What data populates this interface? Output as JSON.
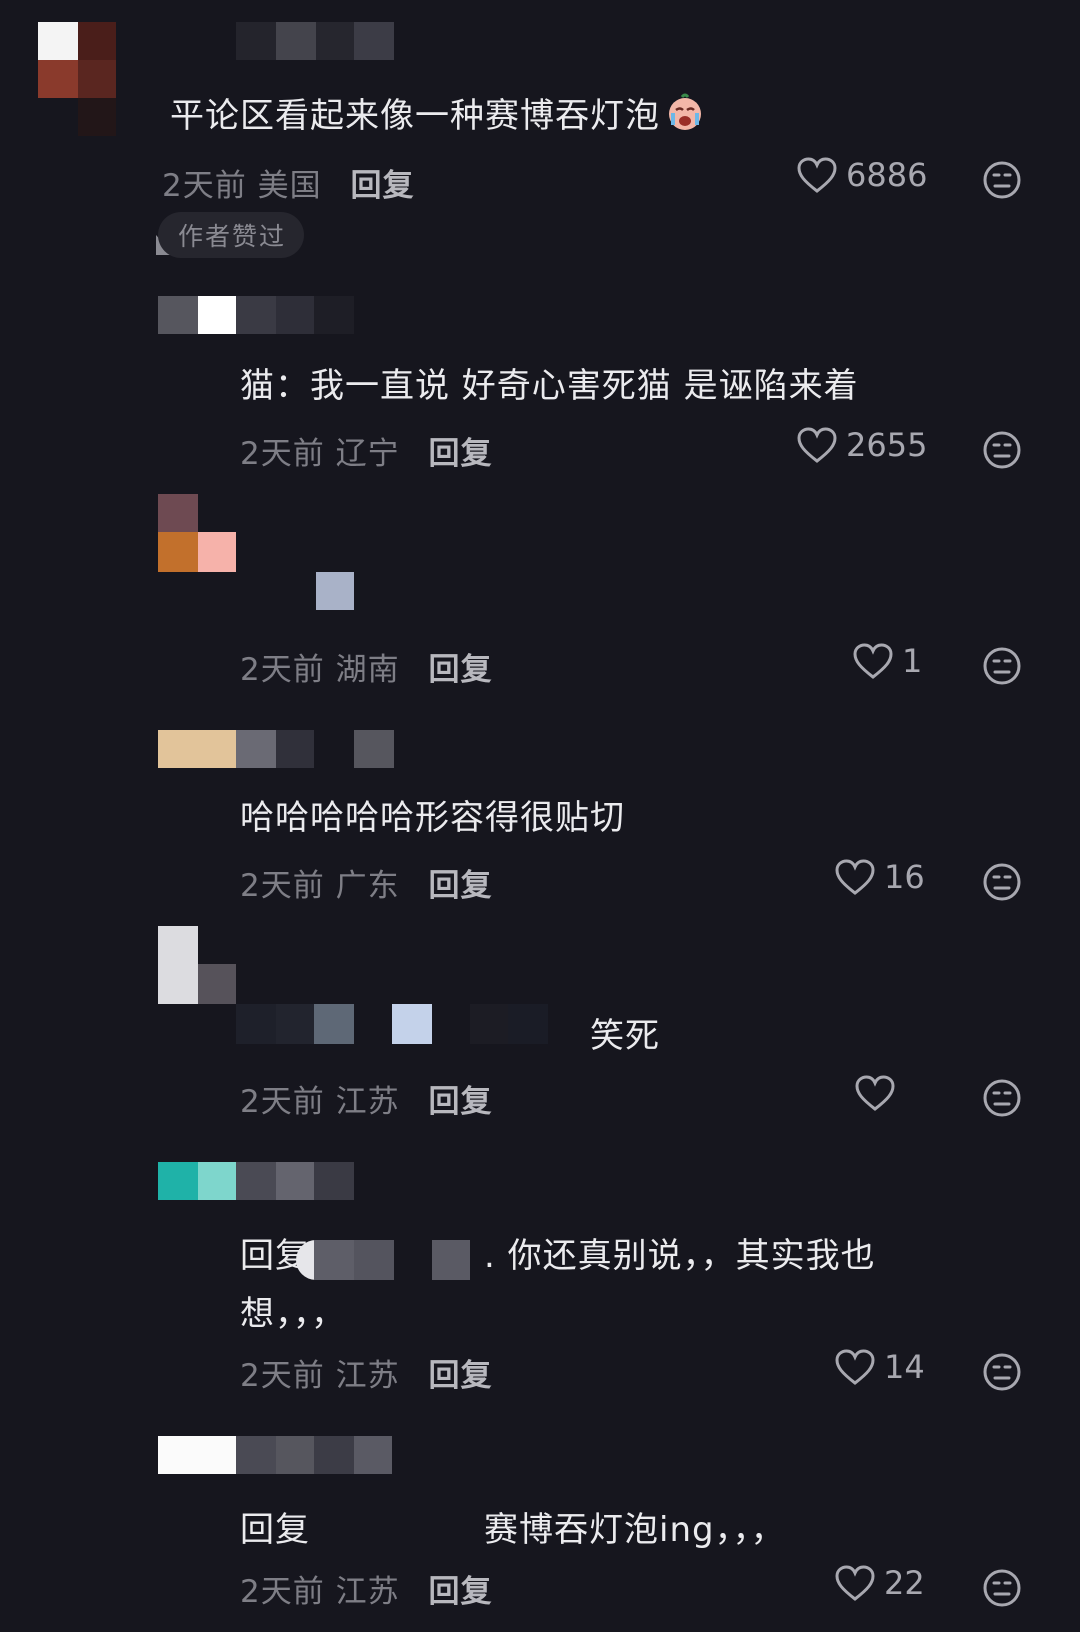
{
  "colors": {
    "background": "#16161e",
    "text": "#ebebee",
    "meta": "#7e7e86",
    "reply": "#b8b8be"
  },
  "comments": [
    {
      "text": "平论区看起来像一种赛博吞灯泡",
      "emoji": "crying-face-emoji",
      "time": "2天前",
      "location": "美国",
      "reply_label": "回复",
      "likes": "6886",
      "badge": "作者赞过"
    },
    {
      "text": "猫：我一直说 好奇心害死猫 是诬陷来着",
      "time": "2天前",
      "location": "辽宁",
      "reply_label": "回复",
      "likes": "2655"
    },
    {
      "text": "",
      "time": "2天前",
      "location": "湖南",
      "reply_label": "回复",
      "likes": "1"
    },
    {
      "text": "哈哈哈哈哈形容得很贴切",
      "time": "2天前",
      "location": "广东",
      "reply_label": "回复",
      "likes": "16"
    },
    {
      "text": "笑死",
      "time": "2天前",
      "location": "江苏",
      "reply_label": "回复",
      "likes": ""
    },
    {
      "text_prefix": "回复",
      "text_line1": ". 你还真别说，，其实我也",
      "text_line2": "想，，，",
      "time": "2天前",
      "location": "江苏",
      "reply_label": "回复",
      "likes": "14"
    },
    {
      "text_prefix": "回复",
      "text": "赛博吞灯泡ing，，，",
      "time": "2天前",
      "location": "江苏",
      "reply_label": "回复",
      "likes": "22"
    }
  ],
  "icons": {
    "like": "heart-outline-icon",
    "react": "expressionless-face-icon"
  }
}
